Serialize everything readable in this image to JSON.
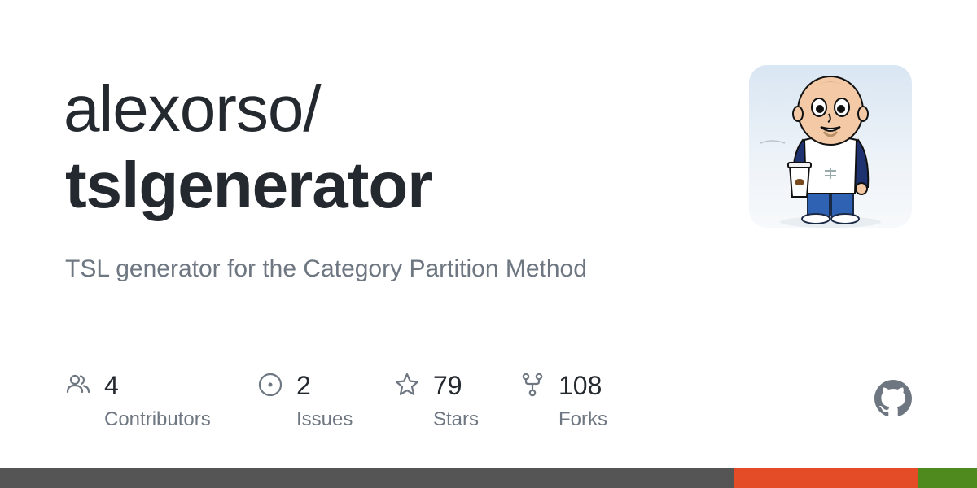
{
  "repo": {
    "owner": "alexorso/",
    "name": "tslgenerator",
    "description": "TSL generator for the Category Partition Method"
  },
  "stats": [
    {
      "icon": "people-icon",
      "value": "4",
      "label": "Contributors"
    },
    {
      "icon": "issue-opened-icon",
      "value": "2",
      "label": "Issues"
    },
    {
      "icon": "star-icon",
      "value": "79",
      "label": "Stars"
    },
    {
      "icon": "repo-forked-icon",
      "value": "108",
      "label": "Forks"
    }
  ],
  "colors": {
    "text": "#24292f",
    "muted": "#6e7781",
    "language_bar": [
      "#555555",
      "#e34c26",
      "#4f8a1e"
    ]
  },
  "icons": {
    "avatar": "owner-avatar-cartoon",
    "logo": "github-mark-icon"
  }
}
